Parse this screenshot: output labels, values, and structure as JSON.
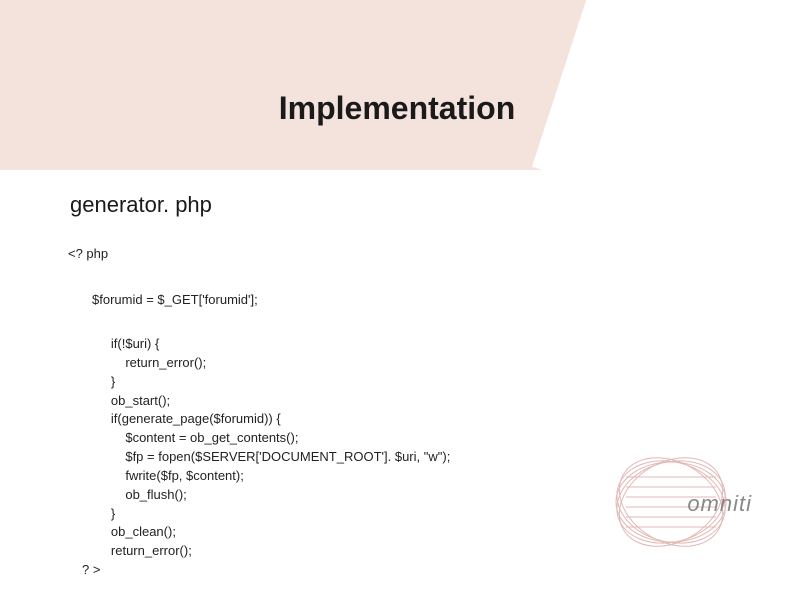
{
  "slide": {
    "title": "Implementation",
    "subtitle": "generator. php",
    "code_open": "<? php",
    "code_line1": "$forumid = $_GET['forumid'];",
    "code_body": "        if(!$uri) {\n            return_error();\n        }\n        ob_start();\n        if(generate_page($forumid)) {\n            $content = ob_get_contents();\n            $fp = fopen($SERVER['DOCUMENT_ROOT']. $uri, \"w\");\n            fwrite($fp, $content);\n            ob_flush();\n        }\n        ob_clean();\n        return_error();\n? >",
    "logo_text": "omniti"
  }
}
